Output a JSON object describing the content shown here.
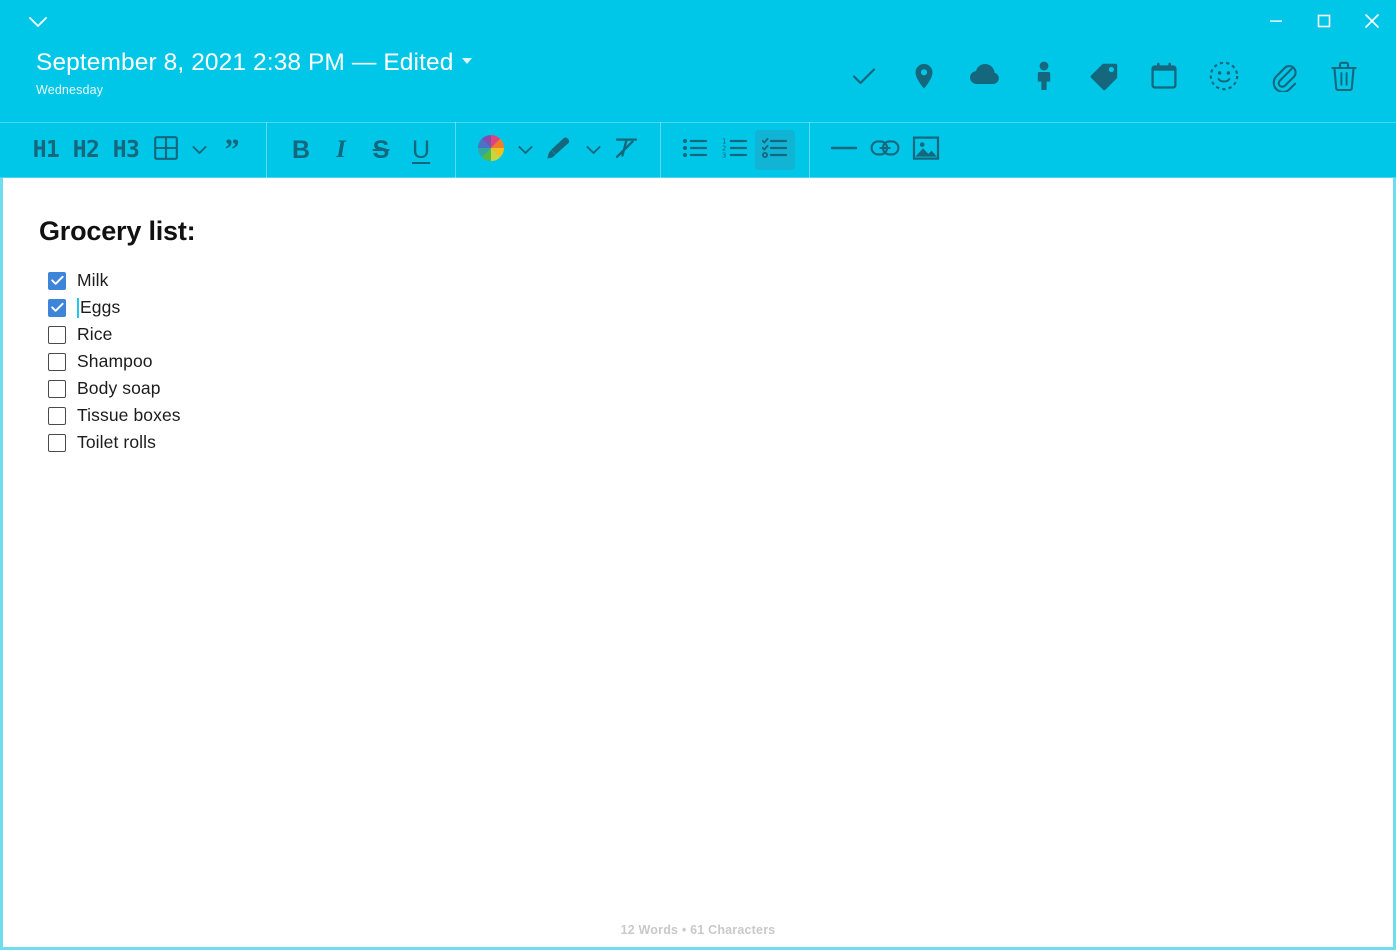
{
  "window": {
    "accent_color": "#00c6e8",
    "icon_color": "#14677c",
    "collapse_icon": "chevron-down-icon",
    "controls": [
      {
        "name": "minimize-button",
        "glyph": "—"
      },
      {
        "name": "maximize-button",
        "glyph": "□"
      },
      {
        "name": "close-button",
        "glyph": "✕"
      }
    ]
  },
  "note": {
    "title": "September 8, 2021 2:38 PM — Edited",
    "weekday": "Wednesday",
    "caret": "dropdown-caret"
  },
  "header_actions": [
    {
      "name": "check-icon",
      "label": "Check"
    },
    {
      "name": "location-pin-icon",
      "label": "Location"
    },
    {
      "name": "cloud-icon",
      "label": "Cloud"
    },
    {
      "name": "person-icon",
      "label": "Person"
    },
    {
      "name": "tag-icon",
      "label": "Tag"
    },
    {
      "name": "calendar-icon",
      "label": "Calendar"
    },
    {
      "name": "smiley-icon",
      "label": "Mood"
    },
    {
      "name": "paperclip-icon",
      "label": "Attach"
    },
    {
      "name": "trash-icon",
      "label": "Delete"
    }
  ],
  "toolbar": {
    "h1_label": "H1",
    "h2_label": "H2",
    "h3_label": "H3",
    "table_icon": "table-icon",
    "table_caret": "chevron-down-icon",
    "quote_label": "”",
    "bold_label": "B",
    "italic_label": "I",
    "strike_label": "S",
    "underline_label": "U",
    "color_icon": "color-wheel-icon",
    "color_caret": "chevron-down-icon",
    "highlight_icon": "highlighter-icon",
    "highlight_caret": "chevron-down-icon",
    "clear_format_icon": "clear-formatting-icon",
    "bullet_list_icon": "bullet-list-icon",
    "numbered_list_icon": "numbered-list-icon",
    "checklist_icon": "checklist-icon",
    "checklist_active": true,
    "divider_icon": "horizontal-rule-icon",
    "link_icon": "link-icon",
    "image_icon": "image-icon"
  },
  "document": {
    "heading": "Grocery list:",
    "items": [
      {
        "label": "Milk",
        "checked": true,
        "cursor": false
      },
      {
        "label": "Eggs",
        "checked": true,
        "cursor": true
      },
      {
        "label": "Rice",
        "checked": false,
        "cursor": false
      },
      {
        "label": "Shampoo",
        "checked": false,
        "cursor": false
      },
      {
        "label": "Body soap",
        "checked": false,
        "cursor": false
      },
      {
        "label": "Tissue boxes",
        "checked": false,
        "cursor": false
      },
      {
        "label": "Toilet rolls",
        "checked": false,
        "cursor": false
      }
    ]
  },
  "status": {
    "text": "12 Words • 61 Characters"
  }
}
